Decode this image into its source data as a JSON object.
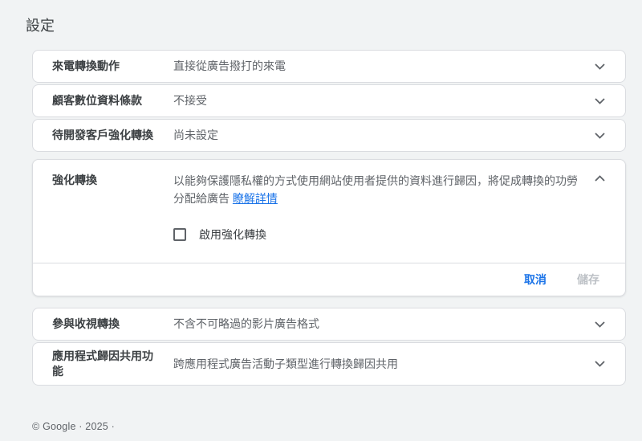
{
  "page": {
    "title": "設定",
    "footer": "© Google · 2025 ·"
  },
  "panels_top": [
    {
      "label": "來電轉換動作",
      "value": "直接從廣告撥打的來電"
    },
    {
      "label": "顧客數位資料條款",
      "value": "不接受"
    },
    {
      "label": "待開發客戶強化轉換",
      "value": "尚未設定"
    }
  ],
  "expanded_panel": {
    "label": "強化轉換",
    "description": "以能夠保護隱私權的方式使用網站使用者提供的資料進行歸因，將促成轉換的功勞分配給廣告",
    "link_label": "瞭解詳情",
    "checkbox_label": "啟用強化轉換",
    "checkbox_checked": false,
    "cancel_label": "取消",
    "save_label": "儲存",
    "save_disabled": true
  },
  "panels_bottom": [
    {
      "label": "參與收視轉換",
      "value": "不含不可略過的影片廣告格式"
    },
    {
      "label": "應用程式歸因共用功能",
      "value": "跨應用程式廣告活動子類型進行轉換歸因共用"
    }
  ],
  "icons": {
    "chevron_down": "chevron-down",
    "chevron_up": "chevron-up"
  },
  "colors": {
    "accent_link": "#1a73e8",
    "label_text": "#3c4043",
    "value_text": "#5f6368",
    "card_border": "#dadce0",
    "page_bg": "#f1f3f4",
    "disabled_button": "#bdc1c6"
  }
}
